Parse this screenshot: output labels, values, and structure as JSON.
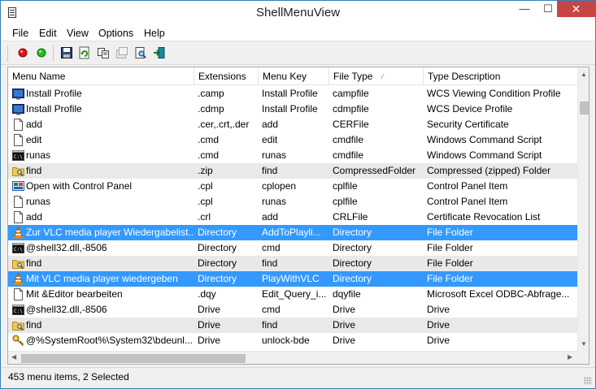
{
  "window": {
    "title": "ShellMenuView",
    "controls": {
      "minimize": "—",
      "maximize": "☐",
      "close": "✕"
    }
  },
  "menu": [
    "File",
    "Edit",
    "View",
    "Options",
    "Help"
  ],
  "toolbar_icons": [
    "enable-red-icon",
    "disable-green-icon",
    "save-icon",
    "refresh-icon",
    "copy-icon",
    "properties-icon",
    "find-icon",
    "exit-icon"
  ],
  "columns": [
    {
      "label": "Menu Name"
    },
    {
      "label": "Extensions"
    },
    {
      "label": "Menu Key"
    },
    {
      "label": "File Type",
      "sorted": "ascending"
    },
    {
      "label": "Type Description"
    }
  ],
  "rows": [
    {
      "icon": "profile-icon",
      "name": "Install Profile",
      "ext": ".camp",
      "key": "Install Profile",
      "type": "campfile",
      "desc": "WCS Viewing Condition Profile",
      "state": "normal"
    },
    {
      "icon": "profile-icon",
      "name": "Install Profile",
      "ext": ".cdmp",
      "key": "Install Profile",
      "type": "cdmpfile",
      "desc": "WCS Device Profile",
      "state": "normal"
    },
    {
      "icon": "document-icon",
      "name": "add",
      "ext": ".cer,.crt,.der",
      "key": "add",
      "type": "CERFile",
      "desc": "Security Certificate",
      "state": "normal"
    },
    {
      "icon": "document-icon",
      "name": "edit",
      "ext": ".cmd",
      "key": "edit",
      "type": "cmdfile",
      "desc": "Windows Command Script",
      "state": "normal"
    },
    {
      "icon": "console-icon",
      "name": "runas",
      "ext": ".cmd",
      "key": "runas",
      "type": "cmdfile",
      "desc": "Windows Command Script",
      "state": "normal"
    },
    {
      "icon": "folder-search-icon",
      "name": "find",
      "ext": ".zip",
      "key": "find",
      "type": "CompressedFolder",
      "desc": "Compressed (zipped) Folder",
      "state": "alt"
    },
    {
      "icon": "control-panel-icon",
      "name": "Open with Control Panel",
      "ext": ".cpl",
      "key": "cplopen",
      "type": "cplfile",
      "desc": "Control Panel Item",
      "state": "normal"
    },
    {
      "icon": "document-icon",
      "name": "runas",
      "ext": ".cpl",
      "key": "runas",
      "type": "cplfile",
      "desc": "Control Panel Item",
      "state": "normal"
    },
    {
      "icon": "document-icon",
      "name": "add",
      "ext": ".crl",
      "key": "add",
      "type": "CRLFile",
      "desc": "Certificate Revocation List",
      "state": "normal"
    },
    {
      "icon": "vlc-icon",
      "name": "Zur VLC media player Wiedergabelist...",
      "ext": "Directory",
      "key": "AddToPlayli...",
      "type": "Directory",
      "desc": "File Folder",
      "state": "selected"
    },
    {
      "icon": "console-icon",
      "name": "@shell32.dll,-8506",
      "ext": "Directory",
      "key": "cmd",
      "type": "Directory",
      "desc": "File Folder",
      "state": "normal"
    },
    {
      "icon": "folder-search-icon",
      "name": "find",
      "ext": "Directory",
      "key": "find",
      "type": "Directory",
      "desc": "File Folder",
      "state": "alt"
    },
    {
      "icon": "vlc-icon",
      "name": "Mit VLC media player wiedergeben",
      "ext": "Directory",
      "key": "PlayWithVLC",
      "type": "Directory",
      "desc": "File Folder",
      "state": "selected"
    },
    {
      "icon": "document-icon",
      "name": "Mit &Editor bearbeiten",
      "ext": ".dqy",
      "key": "Edit_Query_i...",
      "type": "dqyfile",
      "desc": "Microsoft Excel ODBC-Abfrage...",
      "state": "normal"
    },
    {
      "icon": "console-icon",
      "name": "@shell32.dll,-8506",
      "ext": "Drive",
      "key": "cmd",
      "type": "Drive",
      "desc": "Drive",
      "state": "normal"
    },
    {
      "icon": "folder-search-icon",
      "name": "find",
      "ext": "Drive",
      "key": "find",
      "type": "Drive",
      "desc": "Drive",
      "state": "alt"
    },
    {
      "icon": "key-icon",
      "name": "@%SystemRoot%\\System32\\bdeunl...",
      "ext": "Drive",
      "key": "unlock-bde",
      "type": "Drive",
      "desc": "Drive",
      "state": "normal"
    }
  ],
  "status": {
    "text": "453 menu items, 2 Selected"
  }
}
